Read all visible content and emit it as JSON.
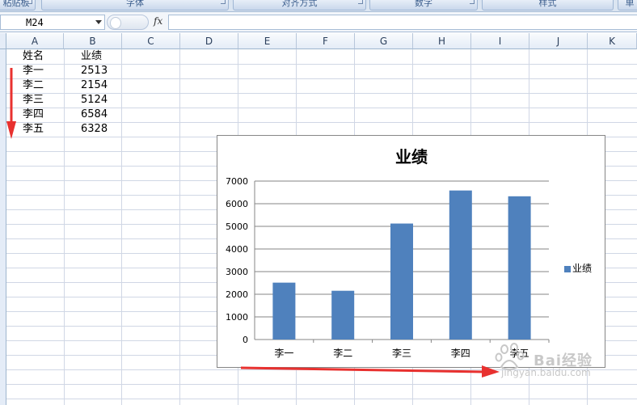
{
  "ribbon": {
    "groups": [
      "粘贴板",
      "字体",
      "对齐方式",
      "数字",
      "样式",
      "单"
    ]
  },
  "formula_bar": {
    "name_box": "M24",
    "fx_label": "fx",
    "formula": ""
  },
  "sheet": {
    "columns": [
      "A",
      "B",
      "C",
      "D",
      "E",
      "F",
      "G",
      "H",
      "I",
      "J",
      "K"
    ],
    "header_row": {
      "a": "姓名",
      "b": "业绩"
    },
    "rows": [
      {
        "a": "李一",
        "b": "2513"
      },
      {
        "a": "李二",
        "b": "2154"
      },
      {
        "a": "李三",
        "b": "5124"
      },
      {
        "a": "李四",
        "b": "6584"
      },
      {
        "a": "李五",
        "b": "6328"
      }
    ]
  },
  "chart_data": {
    "type": "bar",
    "title": "业绩",
    "categories": [
      "李一",
      "李二",
      "李三",
      "李四",
      "李五"
    ],
    "series": [
      {
        "name": "业绩",
        "values": [
          2513,
          2154,
          5124,
          6584,
          6328
        ],
        "color": "#4f81bd"
      }
    ],
    "ylim": [
      0,
      7000
    ],
    "yticks": [
      0,
      1000,
      2000,
      3000,
      4000,
      5000,
      6000,
      7000
    ],
    "grid": true,
    "legend": "right"
  },
  "colors": {
    "bar": "#4f81bd",
    "arrow": "#e8312f",
    "gridline": "#d0d7e5",
    "header_bg": "#e4ecf7"
  },
  "watermark": {
    "brand": "Bai经验",
    "url": "jingyan.baidu.com"
  }
}
